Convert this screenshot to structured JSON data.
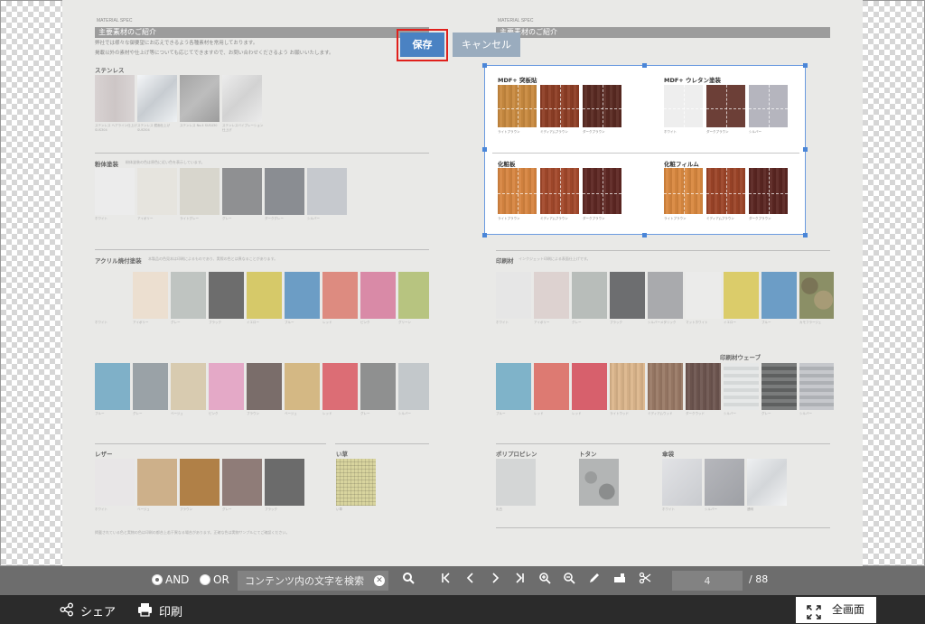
{
  "viewer": {
    "left_page": {
      "spec": "MATERIAL SPEC",
      "title": "主要素材のご紹介",
      "intro1": "弊社では様々な御要望にお応えできるよう各種素材を常用しております。",
      "intro2": "掲載以外の素材や仕上げ等についても応じてできますので、お問い合わせくださるよう お願いいたします。",
      "sections": {
        "stainless": "ステンレス",
        "paint": "粉体塗装",
        "paint_note": "粉体塗装の色は原色に近い色を表示しています。",
        "acrylic": "アクリル焼付塗装",
        "acrylic_note": "本製品の色見本は印刷によるものであり、実際の色とは異なることがあります。",
        "leather": "レザー",
        "igusa": "い草"
      },
      "stainless_caps": [
        "ステンレス ヘアライン仕上げ SUS304",
        "ステンレス 鏡面仕上げ SUS304",
        "ステンレス No.4 SUS430",
        "ステンレスバイブレーション仕上げ"
      ],
      "paint_caps": [
        "ホワイト",
        "アイボリー",
        "ライトグレー",
        "グレー",
        "ダークグレー",
        "シルバー"
      ],
      "acrylic_caps_1": [
        "ホワイト",
        "アイボリー",
        "グレー",
        "ブラック",
        "イエロー",
        "ブルー",
        "レッド",
        "ピンク",
        "グリーン"
      ],
      "acrylic_caps_2": [
        "ブルー",
        "グレー",
        "ベージュ",
        "ピンク",
        "ブラウン",
        "ベージュ",
        "レッド",
        "グレー",
        "シルバー"
      ],
      "leather_caps": [
        "ホワイト",
        "ベージュ",
        "ブラウン",
        "グレー",
        "ブラック"
      ],
      "igusa_caps": [
        "い草"
      ],
      "footnote": "掲載されている色と実物の色は印刷の都合上若干異なる場合があります。正確な色は実物サンプルにてご確認ください。"
    },
    "right_page": {
      "spec": "MATERIAL SPEC",
      "title": "主要素材のご紹介",
      "sections": {
        "mdf_veneer": "MDF+ 突板貼",
        "mdf_urethane": "MDF+ ウレタン塗装",
        "decor_board": "化粧板",
        "decor_film": "化粧フィルム",
        "print": "印刷材",
        "print_note": "インクジェット印刷による表面仕上げです。",
        "print_wave": "印刷材ウェーブ",
        "pp": "ポリプロピレン",
        "totan": "トタン",
        "sanbo": "傘袋"
      },
      "mdf_veneer_caps": [
        "ライトブラウン",
        "ミディアムブラウン",
        "ダークブラウン"
      ],
      "mdf_urethane_caps": [
        "ホワイト",
        "ダークブラウン",
        "シルバー"
      ],
      "decor_board_caps": [
        "ライトブラウン",
        "ミディアムブラウン",
        "ダークブラウン"
      ],
      "decor_film_caps": [
        "ライトブラウン",
        "ミディアムブラウン",
        "ダークブラウン"
      ],
      "print_caps_1": [
        "ホワイト",
        "アイボリー",
        "グレー",
        "ブラック",
        "シルバーメタリック",
        "マットホワイト",
        "イエロー",
        "ブルー",
        "カモフラージュ"
      ],
      "print_caps_2": [
        "ブルー",
        "レッド",
        "レッド",
        "ライトウッド",
        "ミディアムウッド",
        "ダークウッド",
        "シルバー",
        "グレー",
        "シルバー"
      ],
      "pp_caps": [
        "乳白"
      ],
      "sanbo_caps": [
        "ホワイト",
        "シルバー",
        "透明"
      ]
    }
  },
  "edit": {
    "save_label": "保存",
    "cancel_label": "キャンセル"
  },
  "toolbar": {
    "and_label": "AND",
    "or_label": "OR",
    "search_placeholder": "コンテンツ内の文字を検索",
    "page_value": "4",
    "page_total": "/ 88"
  },
  "bottom": {
    "share_label": "シェア",
    "print_label": "印刷",
    "fullscreen_label": "全画面"
  },
  "colors": {
    "accent": "#4a82c3",
    "highlight": "#e0201c",
    "toolbar": "#6d6d6d",
    "bottom_bar": "#2b2b2b"
  }
}
